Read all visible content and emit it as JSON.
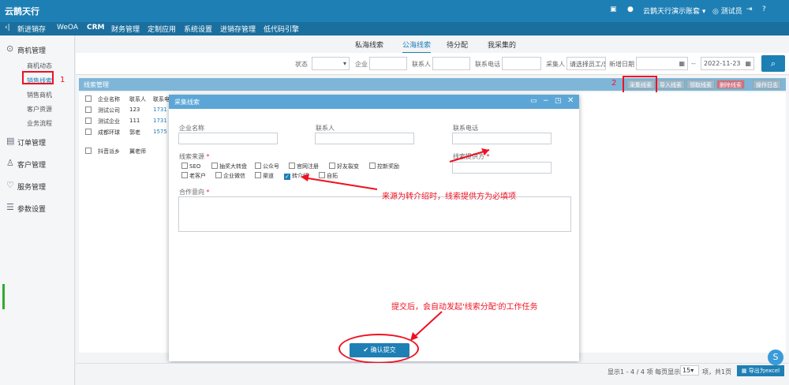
{
  "topbar": {
    "logo": "云鹊天行",
    "badge_icon": "monitor-icon",
    "account": "云鹊天行演示账套",
    "user": "测试员"
  },
  "nav": [
    "新进销存",
    "WeOA",
    "CRM",
    "财务管理",
    "定制应用",
    "系统设置",
    "进销存管理",
    "低代码引擎"
  ],
  "sidebar": {
    "sections": [
      {
        "label": "商机管理"
      },
      {
        "label": "订单管理"
      },
      {
        "label": "客户管理"
      },
      {
        "label": "服务管理"
      },
      {
        "label": "参数设置"
      }
    ],
    "sub": [
      "商机动态",
      "销售线索",
      "销售商机",
      "客户资源",
      "业务流程"
    ]
  },
  "tabs": [
    "私海线索",
    "公海线索",
    "待分配",
    "我采集的"
  ],
  "filter": {
    "status": "状态",
    "company": "企业",
    "contact": "联系人",
    "phone": "联系电话",
    "collector": "采集人",
    "collector_ph": "请选择员工/部",
    "date_label": "新增日期",
    "date_end": "2022-11-23",
    "dash": "--"
  },
  "list": {
    "title": "线索管理",
    "buttons": [
      "采集线索",
      "导入线索",
      "领取线索",
      "删除线索",
      "操作日志"
    ],
    "cols": [
      "企业名称",
      "联系人",
      "联系电"
    ],
    "rows": [
      [
        "测试公司",
        "123",
        "1731"
      ],
      [
        "测试企业",
        "111",
        "1731"
      ],
      [
        "成都环球",
        "郭老",
        "1575"
      ],
      [
        "抖音派乡",
        "翼老师",
        ""
      ]
    ]
  },
  "modal": {
    "title": "采集线索",
    "company": "企业名称",
    "contact": "联系人",
    "phone": "联系电话",
    "source": "线索来源",
    "provider": "线索提供方",
    "intent": "合作意向",
    "req": "*",
    "options": [
      "SEO",
      "抽奖大转盘",
      "公众号",
      "官网注册",
      "好友裂变",
      "控新奖励",
      "老客户",
      "企业微信",
      "渠道",
      "转介绍",
      "自拓"
    ],
    "checked": "转介绍",
    "submit": "确认提交"
  },
  "annotations": {
    "a1": "1",
    "a2": "2",
    "a3": "来源为转介绍时，线索提供方为必填项",
    "a4": "提交后，会自动发起'线索分配'的工作任务"
  },
  "footer": {
    "info": "显示1 - 4 / 4 项  每页显示",
    "per": "15",
    "unit": "项，共1页",
    "export": "导出为excel"
  },
  "colors": {
    "accent": "#1e7fb5",
    "annot": "#e12222"
  }
}
